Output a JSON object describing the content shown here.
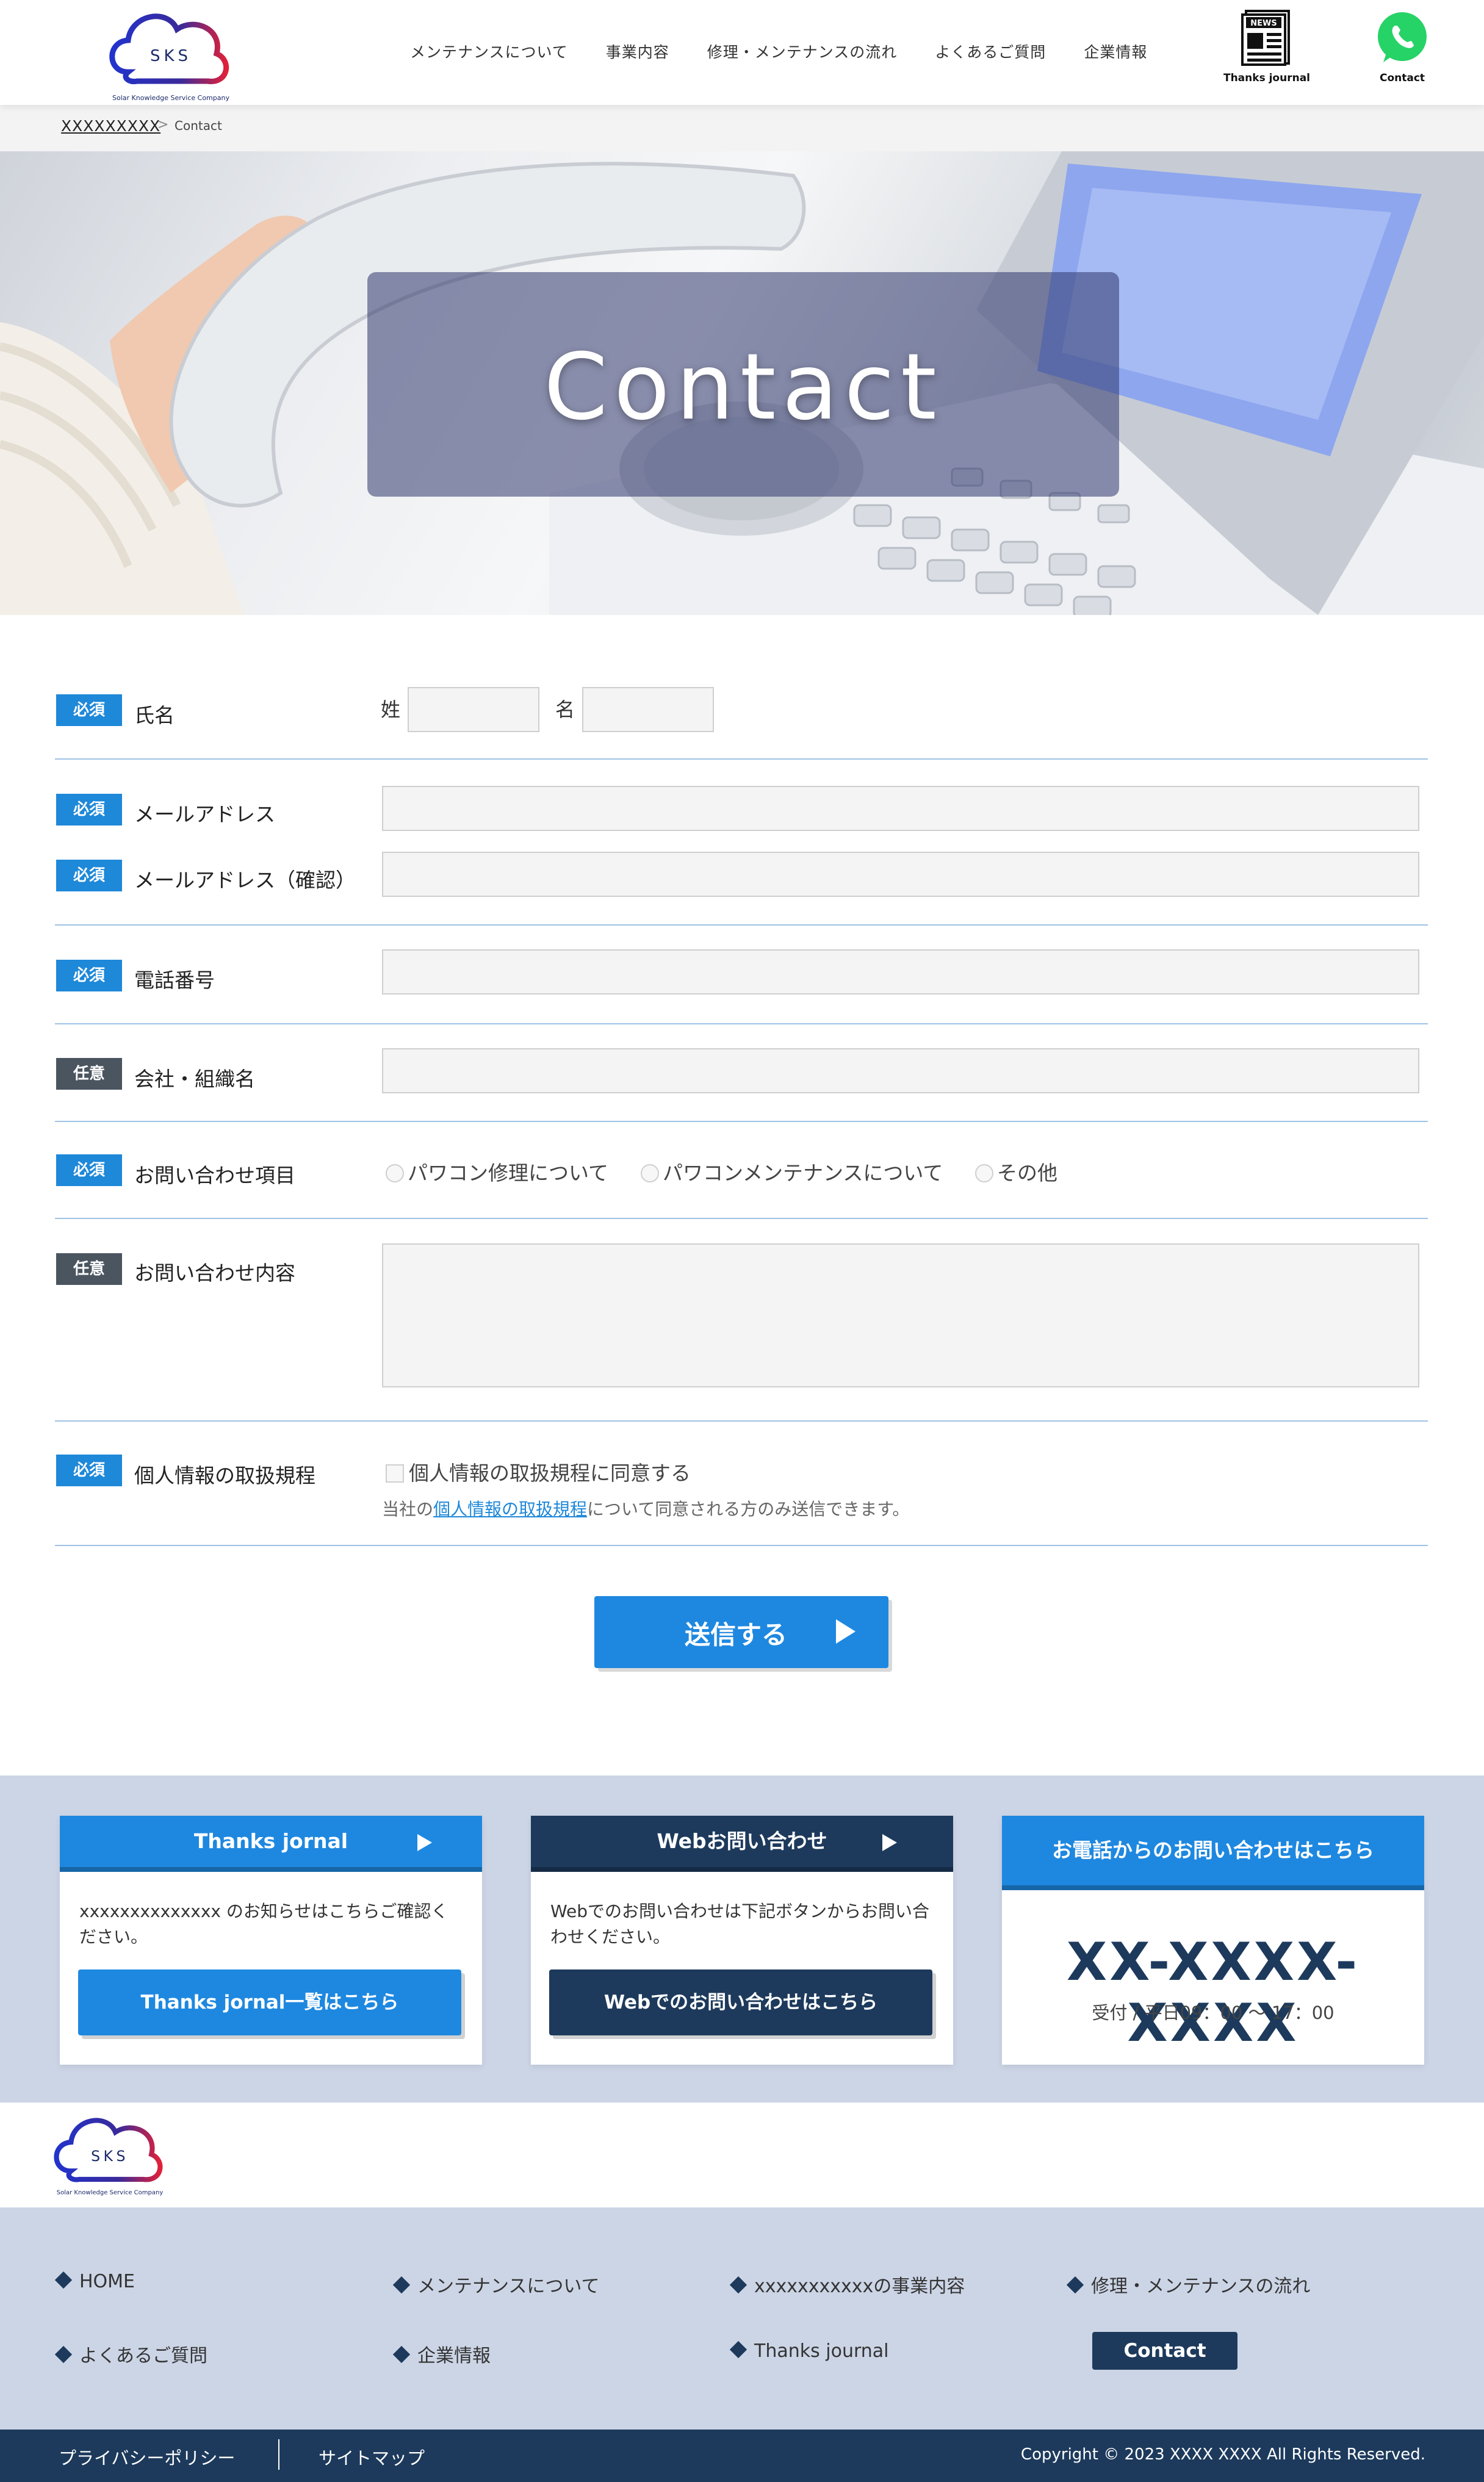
{
  "header": {
    "logo_text": "SKS",
    "logo_caption": "Solar Knowledge Service Company",
    "nav": [
      "メンテナンスについて",
      "事業内容",
      "修理・メンテナンスの流れ",
      "よくあるご質問",
      "企業情報"
    ],
    "news_badge": "NEWS",
    "thanks_label": "Thanks journal",
    "contact_label": "Contact"
  },
  "breadcrumb": {
    "home": "XXXXXXXXX",
    "sep": ">",
    "current": "Contact"
  },
  "hero": {
    "title": "Contact"
  },
  "form": {
    "rows": [
      {
        "badge": "必須",
        "label": "氏名"
      },
      {
        "badge": "必須",
        "label": "メールアドレス"
      },
      {
        "badge": "必須",
        "label": "メールアドレス（確認）"
      },
      {
        "badge": "必須",
        "label": "電話番号"
      },
      {
        "badge": "任意",
        "label": "会社・組織名"
      },
      {
        "badge": "必須",
        "label": "お問い合わせ項目"
      },
      {
        "badge": "任意",
        "label": "お問い合わせ内容"
      },
      {
        "badge": "必須",
        "label": "個人情報の取扱規程"
      }
    ],
    "sei": "姓",
    "mei": "名",
    "radios": [
      "パワコン修理について",
      "パワコンメンテナンスについて",
      "その他"
    ],
    "consent": "個人情報の取扱規程に同意する",
    "note_pre": "当社の",
    "note_link": "個人情報の取扱規程",
    "note_post": "について同意される方のみ送信できます。",
    "submit": "送信する"
  },
  "cards": {
    "thanks": {
      "title": "Thanks jornal",
      "body": "xxxxxxxxxxxxxx のお知らせはこちらご確認ください。",
      "button": "Thanks jornal一覧はこちら"
    },
    "web": {
      "title": "Webお問い合わせ",
      "body": "Webでのお問い合わせは下記ボタンからお問い合わせください。",
      "button": "Webでのお問い合わせはこちら"
    },
    "phone": {
      "title": "お電話からのお問い合わせはこちら",
      "number": "XX-XXXX-XXXX",
      "hours": "受付 / 平日09：00 〜 17：00"
    }
  },
  "footer": {
    "logo_text": "SKS",
    "logo_caption": "Solar Knowledge Service Company",
    "links": [
      "HOME",
      "メンテナンスについて",
      "xxxxxxxxxxxの事業内容",
      "修理・メンテナンスの流れ",
      "よくあるご質問",
      "企業情報",
      "Thanks journal"
    ],
    "contact_button": "Contact",
    "privacy": "プライバシーポリシー",
    "sitemap": "サイトマップ",
    "copyright": "Copyright © 2023 XXXX XXXX All Rights Reserved."
  },
  "colors": {
    "accent": "#1e88e0",
    "navy": "#1d3a5c",
    "section_bg": "#ccd5e6",
    "whatsapp": "#25d366"
  }
}
